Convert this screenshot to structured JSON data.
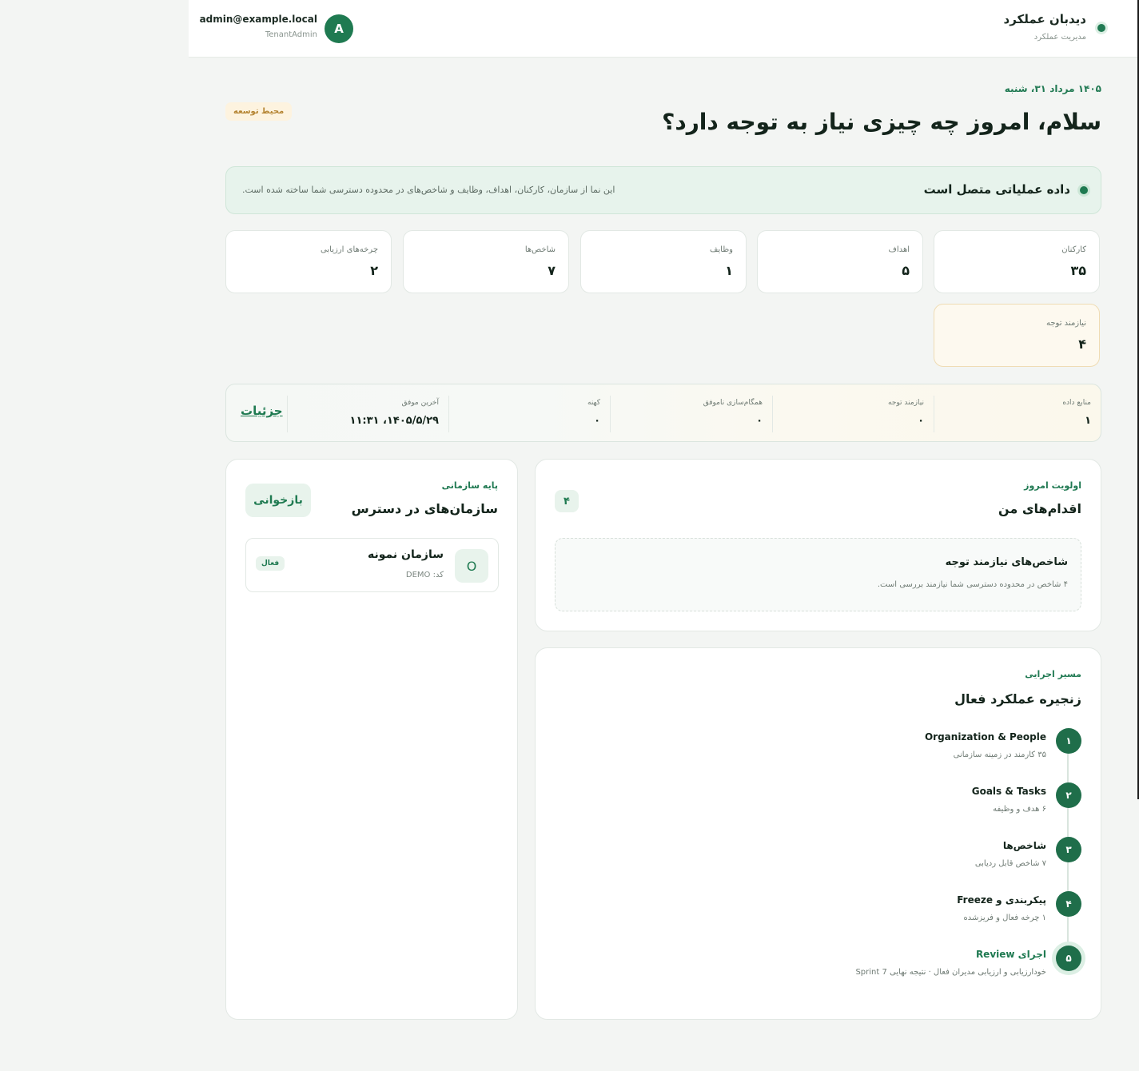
{
  "header": {
    "brand_title": "دیدبان عملکرد",
    "brand_subtitle": "مدیریت عملکرد",
    "user_email": "admin@example.local",
    "user_role": "TenantAdmin",
    "user_initial": "A"
  },
  "greeting": {
    "date": "۱۴۰۵ مرداد ۳۱، شنبه",
    "title": "سلام، امروز چه چیزی نیاز به توجه دارد؟",
    "env_badge": "محیط توسعه"
  },
  "banner": {
    "title": "داده عملیاتی متصل است",
    "text": "این نما از سازمان، کارکنان، اهداف، وظایف و شاخص‌های در محدوده دسترسی شما ساخته شده است."
  },
  "stats": [
    {
      "label": "کارکنان",
      "value": "۳۵"
    },
    {
      "label": "اهداف",
      "value": "۵"
    },
    {
      "label": "وظایف",
      "value": "۱"
    },
    {
      "label": "شاخص‌ها",
      "value": "۷"
    },
    {
      "label": "چرخه‌های ارزیابی",
      "value": "۲"
    },
    {
      "label": "نیازمند توجه",
      "value": "۴"
    }
  ],
  "sources": {
    "cells": [
      {
        "label": "منابع داده",
        "value": "۱"
      },
      {
        "label": "نیازمند توجه",
        "value": "۰"
      },
      {
        "label": "همگام‌سازی ناموفق",
        "value": "۰"
      },
      {
        "label": "کهنه",
        "value": "۰"
      },
      {
        "label": "آخرین موفق",
        "value": "۱۴۰۵/۵/۲۹، ۱۱:۳۱"
      }
    ],
    "details_link": "جزئیات"
  },
  "actions": {
    "eyebrow": "اولویت امروز",
    "title": "اقدام‌های من",
    "count": "۴",
    "item_title": "شاخص‌های نیازمند توجه",
    "item_desc": "۴ شاخص در محدوده دسترسی شما نیازمند بررسی است."
  },
  "orgs": {
    "eyebrow": "پایه سازمانی",
    "title": "سازمان‌های در دسترس",
    "reload": "بازخوانی",
    "items": [
      {
        "icon": "O",
        "name": "سازمان نمونه",
        "code": "کد: DEMO",
        "status": "فعال"
      }
    ]
  },
  "chain": {
    "eyebrow": "مسیر اجرایی",
    "title": "زنجیره عملکرد فعال",
    "steps": [
      {
        "num": "۱",
        "title": "Organization & People",
        "desc": "۳۵ کارمند در زمینه سازمانی"
      },
      {
        "num": "۲",
        "title": "Goals & Tasks",
        "desc": "۶ هدف و وظیفه"
      },
      {
        "num": "۳",
        "title": "شاخص‌ها",
        "desc": "۷ شاخص قابل ردیابی"
      },
      {
        "num": "۴",
        "title": "پیکربندی و Freeze",
        "desc": "۱ چرخه فعال و فریزشده"
      },
      {
        "num": "۵",
        "title": "اجرای Review",
        "desc": "خودارزیابی و ارزیابی مدیران فعال · نتیجه نهایی Sprint 7"
      }
    ]
  },
  "colors": {
    "brand_green": "#1f7a51",
    "warn_bg": "#fdf9ef",
    "badge_text": "#b58533"
  }
}
